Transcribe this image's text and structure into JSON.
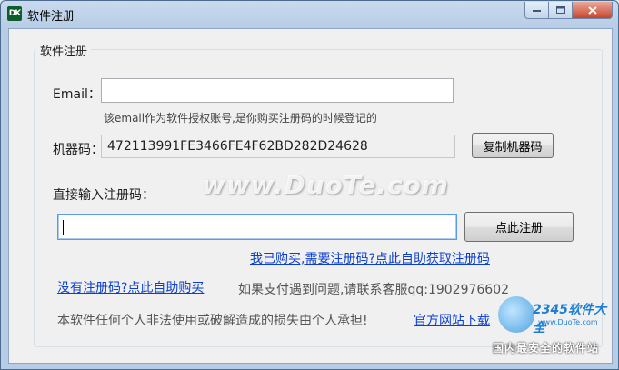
{
  "window": {
    "icon_text": "DK",
    "title": "软件注册"
  },
  "group": {
    "title": "软件注册"
  },
  "email": {
    "label": "Email：",
    "value": "",
    "hint": "该email作为软件授权账号,是你购买注册码的时候登记的"
  },
  "machine": {
    "label": "机器码：",
    "value": "472113991FE3466FE4F62BD282D24628",
    "copy_button": "复制机器码"
  },
  "regcode": {
    "label": "直接输入注册码：",
    "value": "",
    "register_button": "点此注册"
  },
  "links": {
    "bought": "我已购买,需要注册码?点此自助获取注册码",
    "buy": "没有注册码?点此自助购买",
    "official": "官方网站下载"
  },
  "support_text": "如果支付遇到问题,请联系客服qq:1902976602",
  "disclaimer": "本软件任何个人非法使用或破解造成的损失由个人承担!",
  "watermark": "www.DuoTe.com",
  "stamp": {
    "brand": "2345软件大全",
    "url": "www.DuoTe.com",
    "tagline": "国内最安全的软件站"
  },
  "colors": {
    "link": "#0b3fd1",
    "title_bar": "#b7cde6",
    "close_button": "#c8452d"
  }
}
